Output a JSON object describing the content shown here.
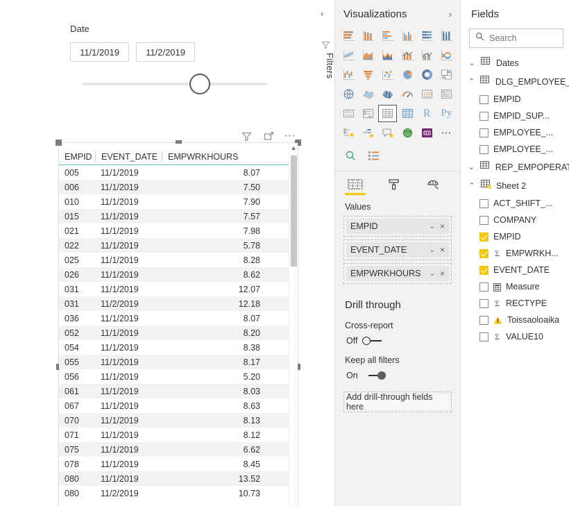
{
  "canvas": {
    "slicer": {
      "title": "Date",
      "start_value": "11/1/2019",
      "end_value": "11/2/2019"
    },
    "visual_header": {
      "filter_icon": "filter-icon",
      "focus_icon": "focus-mode-icon",
      "more_icon": "more-options-icon"
    },
    "table": {
      "columns": [
        "EMPID",
        "EVENT_DATE",
        "EMPWRKHOURS"
      ],
      "rows": [
        [
          "005",
          "11/1/2019",
          "8.07"
        ],
        [
          "006",
          "11/1/2019",
          "7.50"
        ],
        [
          "010",
          "11/1/2019",
          "7.90"
        ],
        [
          "015",
          "11/1/2019",
          "7.57"
        ],
        [
          "021",
          "11/1/2019",
          "7.98"
        ],
        [
          "022",
          "11/1/2019",
          "5.78"
        ],
        [
          "025",
          "11/1/2019",
          "8.28"
        ],
        [
          "026",
          "11/1/2019",
          "8.62"
        ],
        [
          "031",
          "11/1/2019",
          "12.07"
        ],
        [
          "031",
          "11/2/2019",
          "12.18"
        ],
        [
          "036",
          "11/1/2019",
          "8.07"
        ],
        [
          "052",
          "11/1/2019",
          "8.20"
        ],
        [
          "054",
          "11/1/2019",
          "8.38"
        ],
        [
          "055",
          "11/1/2019",
          "8.17"
        ],
        [
          "056",
          "11/1/2019",
          "5.20"
        ],
        [
          "061",
          "11/1/2019",
          "8.03"
        ],
        [
          "067",
          "11/1/2019",
          "8.63"
        ],
        [
          "070",
          "11/1/2019",
          "8.13"
        ],
        [
          "071",
          "11/1/2019",
          "8.12"
        ],
        [
          "075",
          "11/1/2019",
          "6.62"
        ],
        [
          "078",
          "11/1/2019",
          "8.45"
        ],
        [
          "080",
          "11/1/2019",
          "13.52"
        ],
        [
          "080",
          "11/2/2019",
          "10.73"
        ]
      ]
    }
  },
  "rail": {
    "collapse_label": "‹",
    "filters_label": "Filters",
    "filter_icon": "filter-icon"
  },
  "visualizations": {
    "title": "Visualizations",
    "expand_label": "›",
    "icons": [
      "stacked-bar-chart",
      "stacked-column-chart",
      "clustered-bar-chart",
      "clustered-column-chart",
      "100-stacked-bar-chart",
      "100-stacked-column-chart",
      "line-chart",
      "area-chart",
      "stacked-area-chart",
      "line-and-stacked-column-chart",
      "line-and-clustered-column-chart",
      "ribbon-chart",
      "waterfall-chart",
      "funnel-chart",
      "scatter-chart",
      "pie-chart",
      "donut-chart",
      "treemap",
      "map",
      "filled-map",
      "shape-map",
      "gauge",
      "card",
      "multi-row-card",
      "kpi",
      "slicer",
      "table",
      "matrix",
      "r-script-visual",
      "python-visual",
      "key-influencers",
      "decomposition-tree",
      "qna-visual",
      "arcgis-map",
      "paginated-report",
      "more-visuals"
    ],
    "selected_icon_index": 26,
    "tools": [
      "search-visuals-icon",
      "get-more-visuals-icon"
    ],
    "field_tabs": [
      "fields-tab",
      "format-tab",
      "analytics-tab"
    ],
    "active_field_tab": 0,
    "wells_label": "Values",
    "wells": [
      {
        "name": "EMPID",
        "chevron": "⌄",
        "remove": "×"
      },
      {
        "name": "EVENT_DATE",
        "chevron": "⌄",
        "remove": "×"
      },
      {
        "name": "EMPWRKHOURS",
        "chevron": "⌄",
        "remove": "×"
      }
    ],
    "drill_through": {
      "title": "Drill through",
      "cross_report_label": "Cross-report",
      "cross_report_state": "Off",
      "keep_filters_label": "Keep all filters",
      "keep_filters_state": "On",
      "dropzone_label": "Add drill-through fields here"
    }
  },
  "fields": {
    "title": "Fields",
    "search_placeholder": "Search",
    "search_icon": "search-icon",
    "tables": [
      {
        "name": "Dates",
        "expanded": false,
        "chevron": "⌄",
        "icon": "table-icon",
        "fields": []
      },
      {
        "name": "DLG_EMPLOYEE_V",
        "expanded": true,
        "chevron": "⌃",
        "icon": "table-icon",
        "fields": [
          {
            "name": "EMPID",
            "checked": false,
            "marker": "none"
          },
          {
            "name": "EMPID_SUP...",
            "checked": false,
            "marker": "none"
          },
          {
            "name": "EMPLOYEE_...",
            "checked": false,
            "marker": "none"
          },
          {
            "name": "EMPLOYEE_...",
            "checked": false,
            "marker": "none"
          }
        ]
      },
      {
        "name": "REP_EMPOPERAT...",
        "expanded": false,
        "chevron": "⌄",
        "icon": "table-icon",
        "fields": []
      },
      {
        "name": "Sheet 2",
        "expanded": true,
        "chevron": "⌃",
        "icon": "table-used-icon",
        "fields": [
          {
            "name": "ACT_SHIFT_...",
            "checked": false,
            "marker": "none"
          },
          {
            "name": "COMPANY",
            "checked": false,
            "marker": "none"
          },
          {
            "name": "EMPID",
            "checked": true,
            "marker": "none"
          },
          {
            "name": "EMPWRKH...",
            "checked": true,
            "marker": "sigma"
          },
          {
            "name": "EVENT_DATE",
            "checked": true,
            "marker": "none"
          },
          {
            "name": "Measure",
            "checked": false,
            "marker": "calculator"
          },
          {
            "name": "RECTYPE",
            "checked": false,
            "marker": "sigma"
          },
          {
            "name": "Toissaoloaika",
            "checked": false,
            "marker": "warning"
          },
          {
            "name": "VALUE10",
            "checked": false,
            "marker": "sigma"
          }
        ]
      }
    ]
  },
  "colors": {
    "accent_yellow": "#f2c811",
    "header_underline": "#5ec0b4",
    "panel_bg": "#f3f2f1",
    "border": "#e1dfdd"
  }
}
